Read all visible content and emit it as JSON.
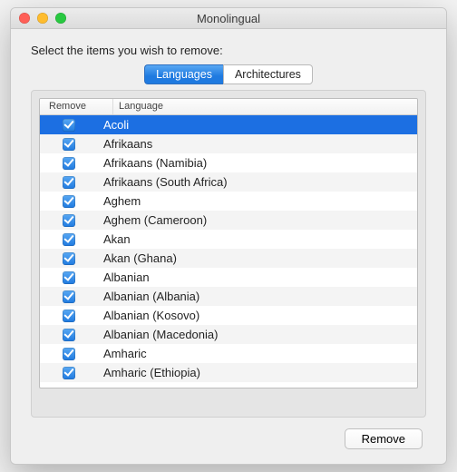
{
  "window": {
    "title": "Monolingual"
  },
  "instruction": "Select the items you wish to remove:",
  "tabs": {
    "languages": "Languages",
    "architectures": "Architectures",
    "selected": "languages"
  },
  "table": {
    "headers": {
      "remove": "Remove",
      "language": "Language"
    },
    "rows": [
      {
        "checked": true,
        "selected": true,
        "label": "Acoli"
      },
      {
        "checked": true,
        "selected": false,
        "label": "Afrikaans"
      },
      {
        "checked": true,
        "selected": false,
        "label": "Afrikaans (Namibia)"
      },
      {
        "checked": true,
        "selected": false,
        "label": "Afrikaans (South Africa)"
      },
      {
        "checked": true,
        "selected": false,
        "label": "Aghem"
      },
      {
        "checked": true,
        "selected": false,
        "label": "Aghem (Cameroon)"
      },
      {
        "checked": true,
        "selected": false,
        "label": "Akan"
      },
      {
        "checked": true,
        "selected": false,
        "label": "Akan (Ghana)"
      },
      {
        "checked": true,
        "selected": false,
        "label": "Albanian"
      },
      {
        "checked": true,
        "selected": false,
        "label": "Albanian (Albania)"
      },
      {
        "checked": true,
        "selected": false,
        "label": "Albanian (Kosovo)"
      },
      {
        "checked": true,
        "selected": false,
        "label": "Albanian (Macedonia)"
      },
      {
        "checked": true,
        "selected": false,
        "label": "Amharic"
      },
      {
        "checked": true,
        "selected": false,
        "label": "Amharic (Ethiopia)"
      }
    ]
  },
  "buttons": {
    "remove": "Remove"
  }
}
